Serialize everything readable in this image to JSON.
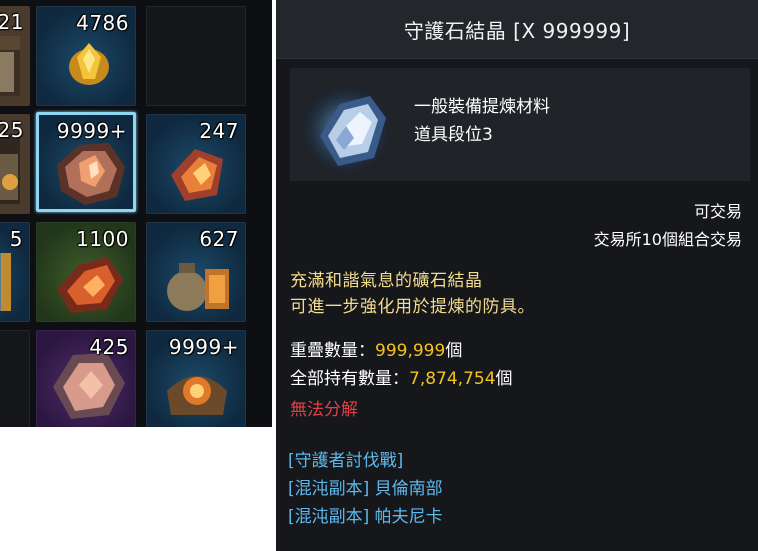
{
  "inventory": {
    "slots": [
      {
        "count": "21",
        "bg": "brown"
      },
      {
        "count": "4786",
        "bg": "blue"
      },
      {
        "count": "",
        "bg": "empty"
      },
      {
        "count": "25",
        "bg": "brown"
      },
      {
        "count": "9999+",
        "bg": "blue",
        "selected": true
      },
      {
        "count": "247",
        "bg": "blue"
      },
      {
        "count": "5",
        "bg": "blue"
      },
      {
        "count": "1100",
        "bg": "green"
      },
      {
        "count": "627",
        "bg": "blue"
      },
      {
        "count": "",
        "bg": "empty"
      },
      {
        "count": "425",
        "bg": "purple"
      },
      {
        "count": "9999+",
        "bg": "blue"
      }
    ]
  },
  "tooltip": {
    "title": "守護石結晶 [X 999999]",
    "item_type": "一般裝備提煉材料",
    "item_tier": "道具段位3",
    "trade_status": "可交易",
    "exchange_info": "交易所10個組合交易",
    "description": [
      "充滿和諧氣息的礦石結晶",
      "可進一步強化用於提煉的防具。"
    ],
    "stack_label": "重疊數量：",
    "stack_value": "999,999",
    "stack_unit": "個",
    "owned_label": "全部持有數量：",
    "owned_value": "7,874,754",
    "owned_unit": "個",
    "disassemble": "無法分解",
    "sources": [
      "[守護者討伐戰]",
      "[混沌副本] 貝倫南部",
      "[混沌副本] 帕夫尼卡"
    ]
  },
  "colors": {
    "description": "#f3dc8c",
    "quantity": "#f6c21e",
    "warning": "#e0404a",
    "link": "#5fb8ec",
    "selection": "#8fd6f2"
  }
}
